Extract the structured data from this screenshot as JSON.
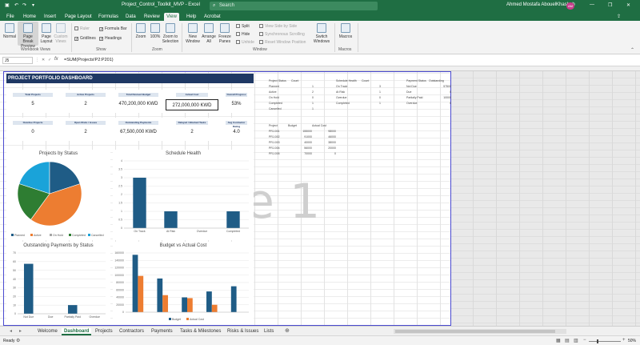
{
  "title_bar": {
    "filename": "Project_Control_Toolkit_MVP",
    "separator": "-",
    "app": "Excel",
    "search_placeholder": "Search",
    "user_name": "Ahmed Mostafa AbouelKhashab",
    "user_initials": "AM",
    "minimize": "—",
    "restore": "❐",
    "close": "✕"
  },
  "ribbon_tabs": [
    "File",
    "Home",
    "Insert",
    "Page Layout",
    "Formulas",
    "Data",
    "Review",
    "View",
    "Help",
    "Acrobat"
  ],
  "active_tab": "View",
  "ribbon": {
    "workbook_views": {
      "name": "Workbook Views",
      "normal": "Normal",
      "page_break": "Page Break Preview",
      "page_layout": "Page Layout",
      "custom": "Custom Views"
    },
    "show": {
      "name": "Show",
      "ruler": "Ruler",
      "gridlines": "Gridlines",
      "formula_bar": "Formula Bar",
      "headings": "Headings"
    },
    "zoom": {
      "name": "Zoom",
      "zoom": "Zoom",
      "hundred": "100%",
      "selection": "Zoom to Selection"
    },
    "window": {
      "name": "Window",
      "new": "New Window",
      "arrange": "Arrange All",
      "freeze": "Freeze Panes",
      "split": "Split",
      "hide": "Hide",
      "unhide": "Unhide",
      "side_by_side": "View Side by Side",
      "sync_scroll": "Synchronous Scrolling",
      "reset_pos": "Reset Window Position",
      "switch": "Switch Windows"
    },
    "macros": {
      "name": "Macros",
      "macros": "Macros"
    }
  },
  "formula_bar": {
    "name_box": "J5",
    "fx": "fx",
    "formula": "=SUM(Projects!P2:P201)"
  },
  "dashboard": {
    "banner": "PROJECT PORTFOLIO DASHBOARD",
    "kpi_row1": [
      {
        "label": "Total Projects",
        "value": "5"
      },
      {
        "label": "Active Projects",
        "value": "2"
      },
      {
        "label": "Total Revised Budget",
        "value": "470,200,000 KWD"
      },
      {
        "label": "Actual Cost",
        "value": "272,000,000 KWD"
      },
      {
        "label": "Overall Progress",
        "value": "53%"
      }
    ],
    "kpi_row2": [
      {
        "label": "Overdue Projects",
        "value": "0"
      },
      {
        "label": "Open Risks / Issues",
        "value": "2"
      },
      {
        "label": "Outstanding Payments",
        "value": "67,500,000 KWD"
      },
      {
        "label": "Delayed / Blocked Tasks",
        "value": "2"
      },
      {
        "label": "Avg Contractor Rating",
        "value": "4.0"
      }
    ]
  },
  "chart_data": [
    {
      "type": "pie",
      "title": "Projects by Status",
      "categories": [
        "Planned",
        "Active",
        "On Hold",
        "Completed",
        "Cancelled"
      ],
      "values": [
        1,
        2,
        0,
        1,
        1
      ],
      "colors": [
        "#1f5c86",
        "#ed7d31",
        "#a5a5a5",
        "#2e7d32",
        "#1aa3d9"
      ]
    },
    {
      "type": "bar",
      "title": "Schedule Health",
      "categories": [
        "On Track",
        "At Risk",
        "Overdue",
        "Completed"
      ],
      "values": [
        3,
        1,
        0,
        1
      ],
      "ylim": [
        0,
        4
      ],
      "color": "#1f5c86"
    },
    {
      "type": "bar",
      "title": "Outstanding Payments by Status",
      "categories": [
        "Not Due",
        "Due",
        "Partially Paid",
        "Overdue"
      ],
      "values": [
        57500000,
        0,
        10000000,
        0
      ],
      "color": "#1f5c86"
    },
    {
      "type": "bar",
      "title": "Budget vs Actual Cost",
      "categories": [
        "PRJ-001",
        "PRJ-002",
        "PRJ-003",
        "PRJ-004",
        "PRJ-005"
      ],
      "series": [
        {
          "name": "Budget",
          "values": [
            155000,
            91000,
            40000,
            56000,
            70000
          ],
          "color": "#1f5c86"
        },
        {
          "name": "Actual Cost",
          "values": [
            98000,
            46000,
            38000,
            20000,
            0
          ],
          "color": "#ed7d31"
        }
      ],
      "ylim": [
        0,
        160000
      ]
    }
  ],
  "side_tables": {
    "status": {
      "headers": [
        "Project Status",
        "Count"
      ],
      "rows": [
        [
          "Planned",
          "1"
        ],
        [
          "Active",
          "2"
        ],
        [
          "On Hold",
          "0"
        ],
        [
          "Completed",
          "1"
        ],
        [
          "Cancelled",
          "1"
        ]
      ]
    },
    "schedule": {
      "headers": [
        "Schedule Health",
        "Count"
      ],
      "rows": [
        [
          "On Track",
          "3"
        ],
        [
          "At Risk",
          "1"
        ],
        [
          "Overdue",
          "0"
        ],
        [
          "Completed",
          "1"
        ]
      ]
    },
    "payments": {
      "headers": [
        "Payment Status",
        "Outstanding"
      ],
      "rows": [
        [
          "Not Due",
          "57500"
        ],
        [
          "Due",
          "0"
        ],
        [
          "Partially Paid",
          "10000"
        ],
        [
          "Overdue",
          "0"
        ]
      ]
    },
    "budget": {
      "headers": [
        "Project",
        "Budget",
        "Actual Cost"
      ],
      "rows": [
        [
          "PRJ-001",
          "155000",
          "98000"
        ],
        [
          "PRJ-002",
          "91000",
          "46000"
        ],
        [
          "PRJ-003",
          "40000",
          "38000"
        ],
        [
          "PRJ-004",
          "56000",
          "20000"
        ],
        [
          "PRJ-005",
          "70000",
          "0"
        ]
      ]
    }
  },
  "watermark": "e 1",
  "sheets": [
    "Welcome",
    "Dashboard",
    "Projects",
    "Contractors",
    "Payments",
    "Tasks & Milestones",
    "Risks & Issues",
    "Lists"
  ],
  "active_sheet": "Dashboard",
  "status_bar": {
    "ready": "Ready",
    "zoom": "50%"
  }
}
